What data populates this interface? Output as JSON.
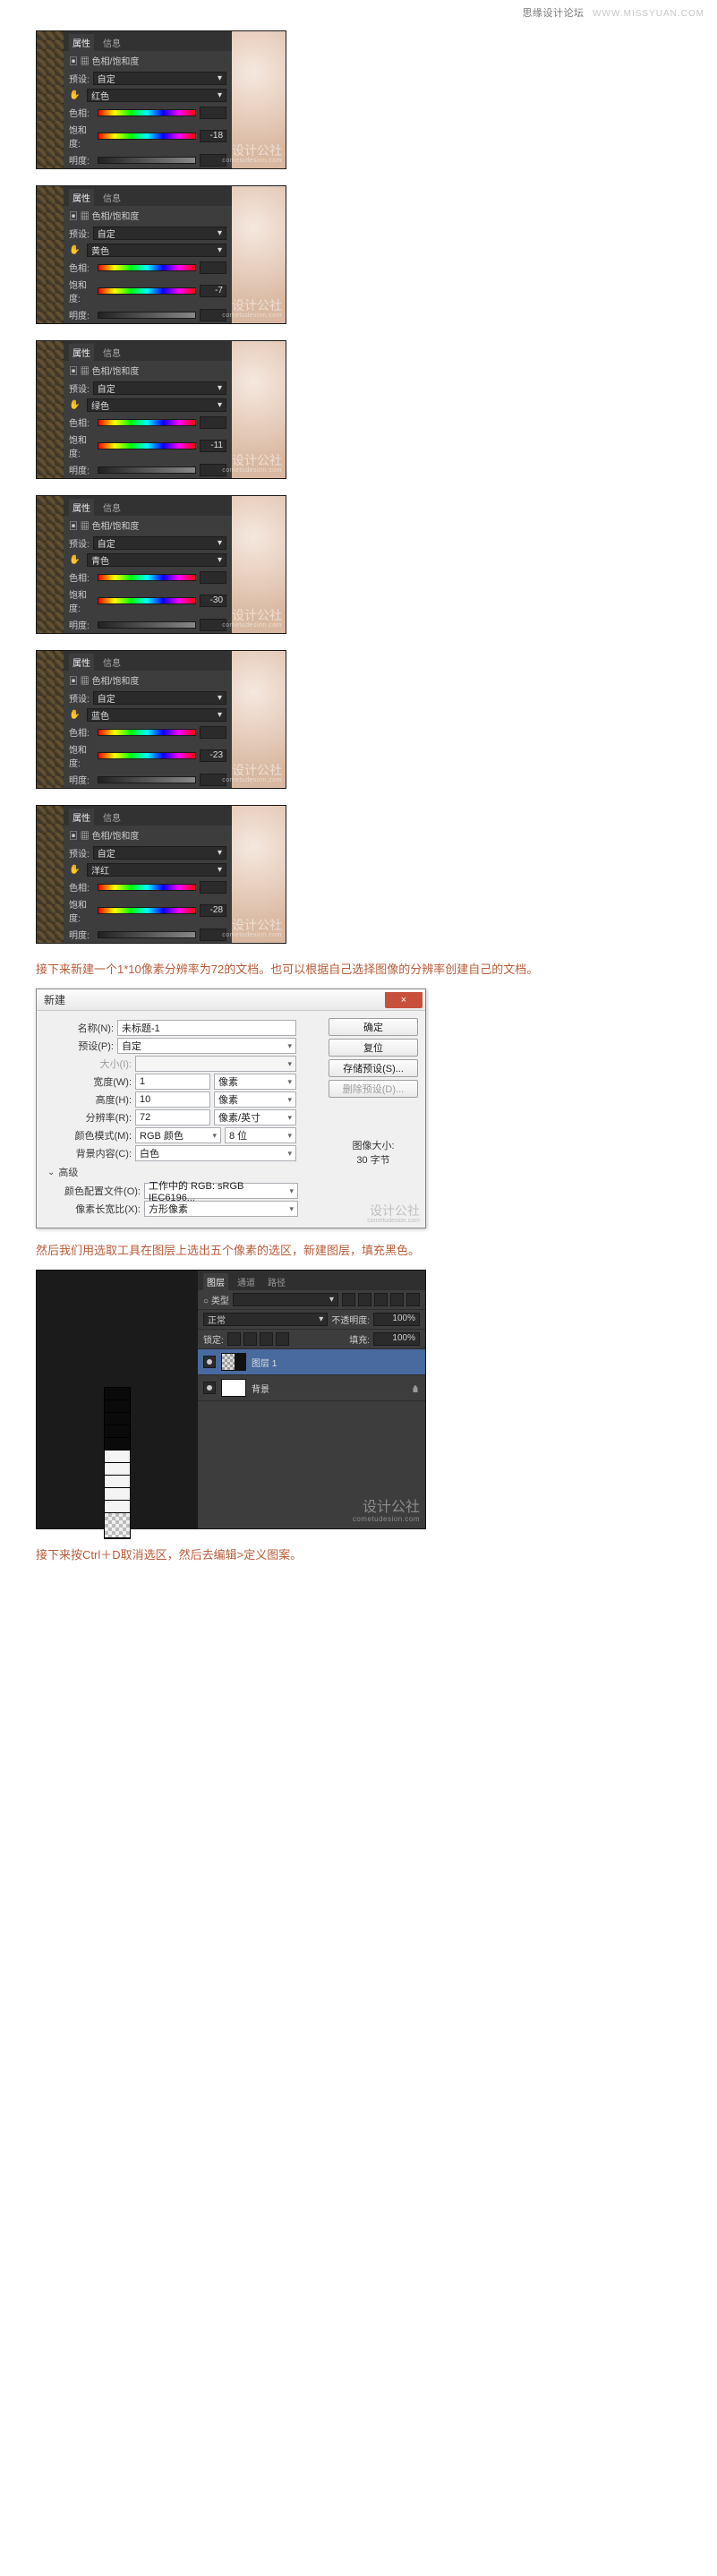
{
  "header": {
    "site": "思缘设计论坛",
    "url": "WWW.MISSYUAN.COM"
  },
  "watermark": {
    "main": "设计公社",
    "sub": "cometudesion.com"
  },
  "hue_panels": [
    {
      "tab_a": "属性",
      "tab_b": "信息",
      "title": "色相/饱和度",
      "preset_lbl": "预设:",
      "preset": "自定",
      "channel": "红色",
      "rows": {
        "hue_lbl": "色相:",
        "hue": "",
        "sat_lbl": "饱和度:",
        "sat": "-18",
        "light_lbl": "明度:",
        "light": ""
      }
    },
    {
      "tab_a": "属性",
      "tab_b": "信息",
      "title": "色相/饱和度",
      "preset_lbl": "预设:",
      "preset": "自定",
      "channel": "黄色",
      "rows": {
        "hue_lbl": "色相:",
        "hue": "",
        "sat_lbl": "饱和度:",
        "sat": "-7",
        "light_lbl": "明度:",
        "light": ""
      }
    },
    {
      "tab_a": "属性",
      "tab_b": "信息",
      "title": "色相/饱和度",
      "preset_lbl": "预设:",
      "preset": "自定",
      "channel": "绿色",
      "rows": {
        "hue_lbl": "色相:",
        "hue": "",
        "sat_lbl": "饱和度:",
        "sat": "-11",
        "light_lbl": "明度:",
        "light": ""
      }
    },
    {
      "tab_a": "属性",
      "tab_b": "信息",
      "title": "色相/饱和度",
      "preset_lbl": "预设:",
      "preset": "自定",
      "channel": "青色",
      "rows": {
        "hue_lbl": "色相:",
        "hue": "",
        "sat_lbl": "饱和度:",
        "sat": "-30",
        "light_lbl": "明度:",
        "light": ""
      }
    },
    {
      "tab_a": "属性",
      "tab_b": "信息",
      "title": "色相/饱和度",
      "preset_lbl": "预设:",
      "preset": "自定",
      "channel": "蓝色",
      "rows": {
        "hue_lbl": "色相:",
        "hue": "",
        "sat_lbl": "饱和度:",
        "sat": "-23",
        "light_lbl": "明度:",
        "light": ""
      }
    },
    {
      "tab_a": "属性",
      "tab_b": "信息",
      "title": "色相/饱和度",
      "preset_lbl": "预设:",
      "preset": "自定",
      "channel": "洋红",
      "rows": {
        "hue_lbl": "色相:",
        "hue": "",
        "sat_lbl": "饱和度:",
        "sat": "-28",
        "light_lbl": "明度:",
        "light": ""
      }
    }
  ],
  "caption1": "接下来新建一个1*10像素分辨率为72的文档。也可以根据自己选择图像的分辨率创建自己的文档。",
  "dialog": {
    "title": "新建",
    "close": "×",
    "name_lbl": "名称(N):",
    "name": "未标题-1",
    "preset_lbl": "预设(P):",
    "preset": "自定",
    "size_lbl": "大小(I):",
    "width_lbl": "宽度(W):",
    "width": "1",
    "width_unit": "像素",
    "height_lbl": "高度(H):",
    "height": "10",
    "height_unit": "像素",
    "res_lbl": "分辨率(R):",
    "res": "72",
    "res_unit": "像素/英寸",
    "mode_lbl": "颜色模式(M):",
    "mode": "RGB 颜色",
    "mode_depth": "8 位",
    "bg_lbl": "背景内容(C):",
    "bg": "白色",
    "adv": "高级",
    "profile_lbl": "颜色配置文件(O):",
    "profile": "工作中的 RGB: sRGB IEC6196...",
    "aspect_lbl": "像素长宽比(X):",
    "aspect": "方形像素",
    "btn_ok": "确定",
    "btn_cancel": "复位",
    "btn_save": "存储预设(S)...",
    "btn_del": "删除预设(D)...",
    "meta_lbl": "图像大小:",
    "meta_val": "30 字节"
  },
  "caption2": "然后我们用选取工具在图层上选出五个像素的选区，新建图层，填充黑色。",
  "layers": {
    "tabs": {
      "a": "图层",
      "b": "通道",
      "c": "路径"
    },
    "kind_lbl": "○ 类型",
    "mode": "正常",
    "opacity_lbl": "不透明度:",
    "opacity": "100%",
    "lock_lbl": "锁定:",
    "fill_lbl": "填充:",
    "fill": "100%",
    "items": [
      {
        "name": "图层 1",
        "sel": true
      },
      {
        "name": "背景",
        "locked": true
      }
    ]
  },
  "caption3": "接下来按Ctrl＋D取消选区，然后去编辑>定义图案。"
}
